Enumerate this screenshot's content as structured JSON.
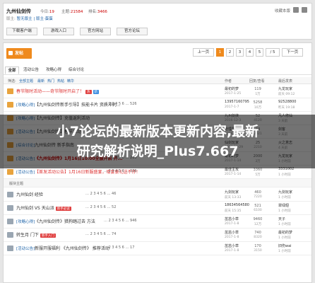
{
  "header": {
    "forum_name": "九州仙剑传",
    "today_label": "今日:",
    "today_value": "19",
    "topics_label": "主题:",
    "topics_value": "21584",
    "rank_label": "排名:",
    "rank_value": "3466",
    "moderators_label": "版主:",
    "moderators": "暂无版主 | 版主·蛋蛋",
    "favorite_label": "收藏本版"
  },
  "category_buttons": [
    "下载客户端",
    "游戏入口",
    "官方网站",
    "官方论坛"
  ],
  "toolbar": {
    "post_label": "发帖",
    "prev_label": "上一页",
    "pages": [
      "1",
      "2",
      "3",
      "4",
      "5"
    ],
    "page_input": "/ 5",
    "next_label": "下一页"
  },
  "tabs": [
    "全部",
    "活动公告",
    "攻略心得",
    "综合讨论"
  ],
  "column_header": {
    "filter_label": "筛选:",
    "filters": [
      "全部主题",
      "最新",
      "热门",
      "热帖",
      "精华"
    ],
    "author_label": "作者",
    "replies_label": "回复/查看",
    "last_label": "最后发表"
  },
  "overlay": {
    "line1": "小7论坛的最新版本更新内容,最新",
    "line2": "研究解析说明_Plus7.667"
  },
  "pinned_rows": [
    {
      "tag": "",
      "title": "春节限时活动——奇节限时开启了！",
      "style": "red",
      "badge": "热",
      "badge2": "新",
      "pages": "",
      "author": "最初的梦",
      "adate": "2017-1-25",
      "replies": "119",
      "views": "1万",
      "last": "九龙玩家",
      "ldate": "前天 09:12"
    },
    {
      "tag": "[攻略心得]",
      "title": "【九州仙剑传新手引导】技能卡片 资质冲刺...",
      "style": "normal",
      "badge": "",
      "badge2": "",
      "pages": "… 2 3 4 5 6 … 526",
      "author": "13957160795",
      "adate": "2017-1-7",
      "replies": "5258",
      "views": "10万",
      "last": "92528800",
      "ldate": "昨天 19:18"
    },
    {
      "tag": "[攻略心得]",
      "title": "【九州仙剑传】充值返利活动",
      "style": "normal",
      "badge": "",
      "badge2": "",
      "pages": "",
      "author": "九州剑侠",
      "adate": "2016-12-3",
      "replies": "52",
      "views": "4120",
      "last": "凡人修仙",
      "ldate": "3 天前"
    },
    {
      "tag": "[活动公告]",
      "title": "【九州仙剑传】春节活动",
      "style": "normal",
      "badge": "",
      "badge2": "",
      "pages": "",
      "author": "管理员",
      "adate": "2016-12-1",
      "replies": "34",
      "views": "3021",
      "last": "剑客",
      "ldate": "3 天前"
    },
    {
      "tag": "[综合讨论]",
      "title": "九州仙剑传 新手指南",
      "style": "normal",
      "badge": "",
      "badge2": "",
      "pages": "",
      "author": "仙剑玩家",
      "adate": "2016-11-29",
      "replies": "25",
      "views": "2210",
      "last": "火之意志",
      "ldate": "4 天前"
    },
    {
      "tag": "[活动公告]",
      "title": "《九州仙剑传》1月16日10:00全服开启 开...",
      "style": "strong",
      "badge": "",
      "badge2": "",
      "pages": "… 2 3 4 5 6 … 200",
      "author": "最初的梦",
      "adate": "2017-1-14",
      "replies": "2000",
      "views": "3万",
      "last": "九龙玩家",
      "ldate": "1 小时前"
    },
    {
      "tag": "[活动公告]",
      "title": "【首发活动公告】1月16日新服盛宴，壕宴豪礼送不停！",
      "style": "red",
      "badge": "",
      "badge2": "",
      "pages": "… 2 3 4 5 6 … 336",
      "author": "最佳主攻",
      "adate": "2017-1-14",
      "replies": "3360",
      "views": "5万",
      "last": "3331002",
      "ldate": "1 小时前"
    }
  ],
  "divider_label": "版块主题",
  "normal_rows": [
    {
      "tag": "",
      "title": "九州仙剑 经验",
      "style": "normal",
      "badge": "",
      "pages": "… 2 3 4 5 6 … 46",
      "author": "九剑玩家",
      "adate": "前天 13:33",
      "replies": "460",
      "views": "7220",
      "last": "九剑玩家",
      "ldate": "1 小时前"
    },
    {
      "tag": "",
      "title": "九州仙剑 VS 天山派",
      "style": "normal",
      "badge": "新手必读",
      "pages": "… 2 3 4 5 6 … 52",
      "author": "18634564580",
      "adate": "前天 15:35",
      "replies": "521",
      "views": "6100",
      "last": "翠绿翅",
      "ldate": "1 小时前"
    },
    {
      "tag": "[攻略心得]",
      "title": "《九州仙剑传》猎狗踏过去 方法",
      "style": "normal",
      "badge": "",
      "pages": "… 2 3 4 5 6 … 946",
      "author": "茁茁小草",
      "adate": "2017-1-8",
      "replies": "9460",
      "views": "12万",
      "last": "天子",
      "ldate": "1 小时前"
    },
    {
      "tag": "",
      "title": "转生月 门下",
      "style": "normal",
      "badge": "新手入门",
      "pages": "… 2 3 4 5 6 … 74",
      "author": "茁茁小草",
      "adate": "2017-1-8",
      "replies": "740",
      "views": "8320",
      "last": "最初的梦",
      "ldate": "1 小时前"
    },
    {
      "tag": "[活动公告]",
      "title": "新服开服福利 《九州仙剑传》 推荐活动",
      "style": "normal",
      "badge": "",
      "pages": "… 2 3 4 5 6 … 17",
      "author": "茁茁小草",
      "adate": "2017-1-8",
      "replies": "170",
      "views": "3150",
      "last": "旧伤wai",
      "ldate": "1 小时前"
    }
  ]
}
